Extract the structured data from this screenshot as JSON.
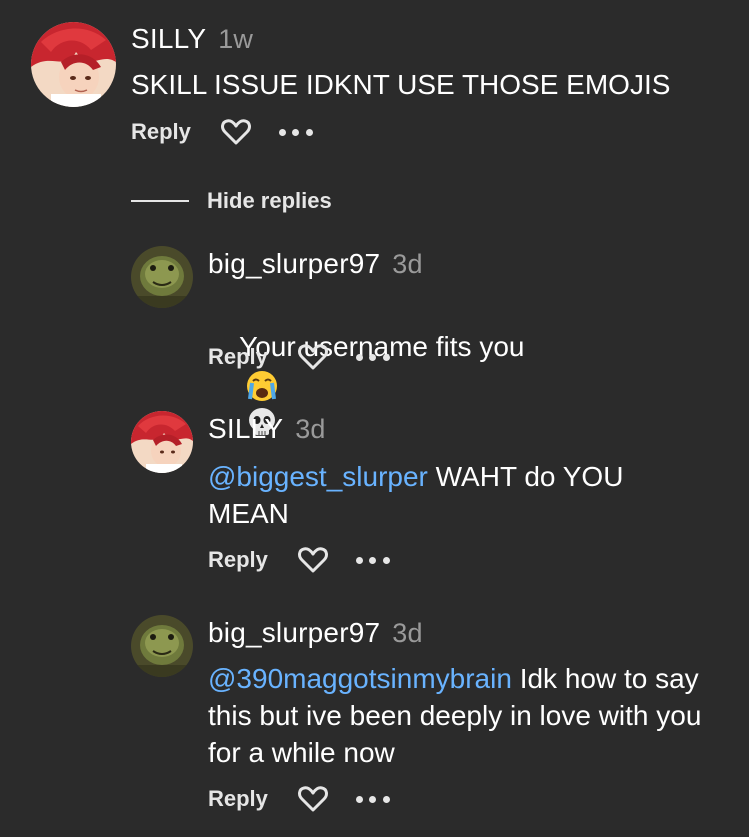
{
  "comments": [
    {
      "username": "SILLY",
      "time": "1w",
      "text": "SKILL ISSUE IDKNT USE THOSE EMOJIS",
      "reply_label": "Reply",
      "avatar": "anime-red-hair-avatar"
    }
  ],
  "hide_replies_label": "Hide replies",
  "replies": [
    {
      "username": "big_slurper97",
      "time": "3d",
      "text": "Your username fits you",
      "emojis": [
        "loudly-crying-face",
        "skull"
      ],
      "reply_label": "Reply",
      "avatar": "turtle-avatar"
    },
    {
      "username": "SILLY",
      "time": "3d",
      "mention": "@biggest_slurper",
      "text": " WAHT do YOU MEAN",
      "reply_label": "Reply",
      "avatar": "anime-red-hair-avatar"
    },
    {
      "username": "big_slurper97",
      "time": "3d",
      "mention": "@390maggotsinmybrain",
      "text": " Idk how to say this but ive been deeply in love with you for a while now",
      "reply_label": "Reply",
      "avatar": "turtle-avatar"
    }
  ],
  "colors": {
    "background": "#2b2b2b",
    "mention": "#69b3ff",
    "timestamp": "#9a9a9a"
  }
}
